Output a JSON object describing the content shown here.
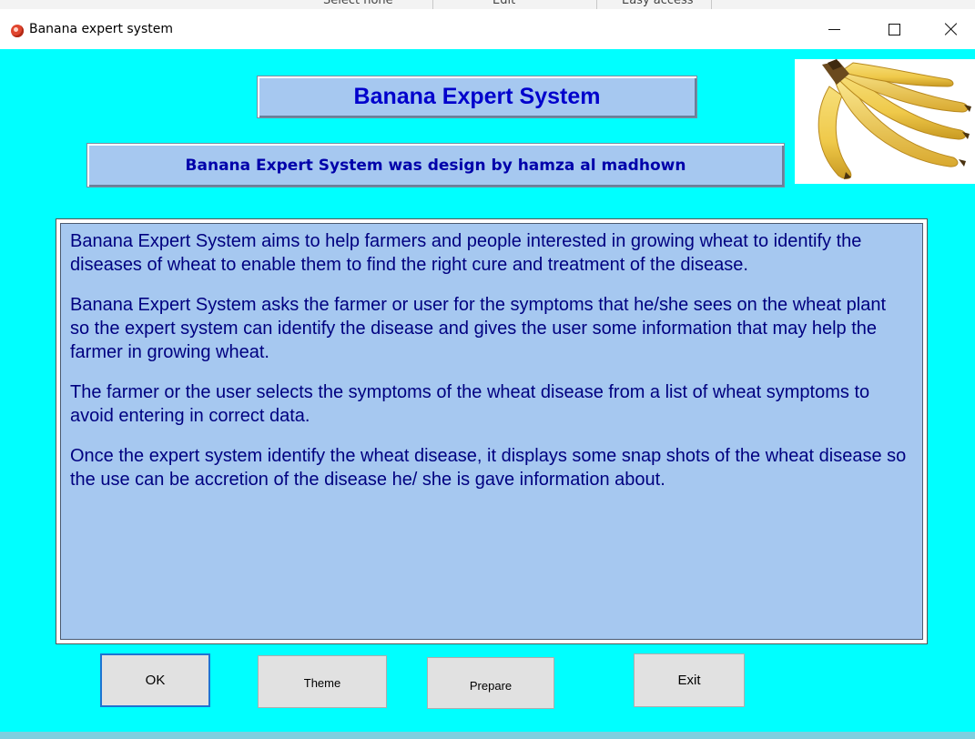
{
  "background_app": {
    "toolbar_items": [
      "Select none",
      "Edit",
      "Easy access"
    ]
  },
  "window": {
    "title": "Banana expert system",
    "controls": {
      "minimize_icon": "minimize-icon",
      "maximize_icon": "maximize-icon",
      "close_icon": "close-icon"
    }
  },
  "header": {
    "title": "Banana Expert System",
    "subtitle": "Banana Expert System was design by hamza al madhown",
    "image": "banana-bunch-image"
  },
  "description": {
    "paragraphs": [
      "Banana Expert System aims to help farmers and people interested in growing wheat to identify the diseases of wheat to enable them to find the right cure and treatment of the disease.",
      "Banana Expert System asks the farmer or user for the symptoms that  he/she sees on the wheat plant so the expert system can identify the disease and gives the user some information that may help the farmer in growing wheat.",
      "The farmer or the user selects the symptoms of the wheat disease from a list of wheat symptoms to avoid entering in correct data.",
      "Once the expert  system identify the wheat disease, it displays some snap shots of the wheat disease so the use can be accretion of the disease he/ she is gave information  about."
    ]
  },
  "buttons": {
    "ok": "OK",
    "theme": "Theme",
    "prepare": "Prepare",
    "exit": "Exit"
  },
  "colors": {
    "client_background": "#00ffff",
    "panel_background": "#a6c8f0",
    "title_text": "#0000cc",
    "body_text": "#000080",
    "focus_border": "#1e73d2"
  }
}
